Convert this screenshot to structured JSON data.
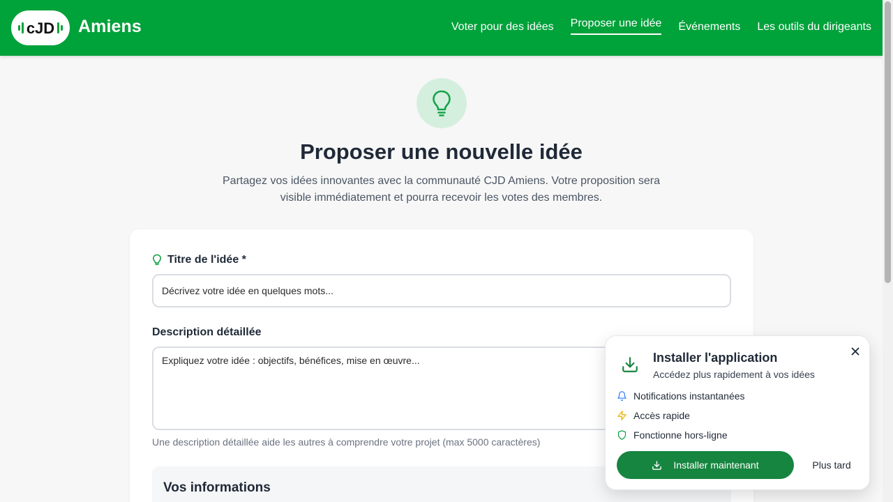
{
  "header": {
    "logo_text": "CJD",
    "brand": "Amiens",
    "nav": [
      {
        "label": "Voter pour des idées",
        "active": false
      },
      {
        "label": "Proposer une idée",
        "active": true
      },
      {
        "label": "Événements",
        "active": false
      },
      {
        "label": "Les outils du dirigeants",
        "active": false
      }
    ]
  },
  "hero": {
    "title": "Proposer une nouvelle idée",
    "subtitle": "Partagez vos idées innovantes avec la communauté CJD Amiens. Votre proposition sera visible immédiatement et pourra recevoir les votes des membres."
  },
  "form": {
    "title_label": "Titre de l'idée *",
    "title_placeholder": "Décrivez votre idée en quelques mots...",
    "description_label": "Description détaillée",
    "description_placeholder": "Expliquez votre idée : objectifs, bénéfices, mise en œuvre...",
    "description_help": "Une description détaillée aide les autres à comprendre votre projet (max 5000 caractères)",
    "info_section_title": "Vos informations"
  },
  "install_popup": {
    "title": "Installer l'application",
    "subtitle": "Accédez plus rapidement à vos idées",
    "features": [
      {
        "icon": "bell-icon",
        "label": "Notifications instantanées"
      },
      {
        "icon": "lightning-icon",
        "label": "Accès rapide"
      },
      {
        "icon": "shield-icon",
        "label": "Fonctionne hors-ligne"
      }
    ],
    "install_button": "Installer maintenant",
    "later_button": "Plus tard"
  },
  "colors": {
    "brand_green": "#00a23a",
    "button_green": "#16853f",
    "hero_icon_bg": "#d5efdf",
    "bell_blue": "#3b82f6",
    "lightning_yellow": "#eab308",
    "shield_green": "#16a34a"
  }
}
